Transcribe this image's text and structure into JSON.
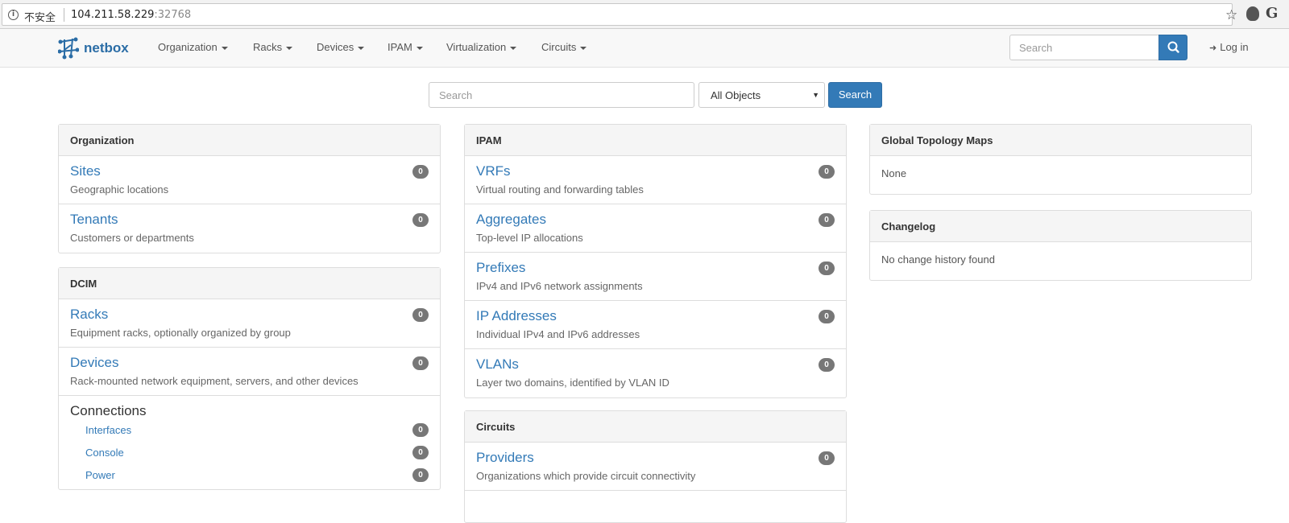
{
  "browser": {
    "security_label": "不安全",
    "url_host": "104.211.58.229",
    "url_port": ":32768"
  },
  "navbar": {
    "brand": "netbox",
    "menus": [
      "Organization",
      "Racks",
      "Devices",
      "IPAM",
      "Virtualization",
      "Circuits"
    ],
    "search_placeholder": "Search",
    "login": "Log in"
  },
  "search": {
    "placeholder": "Search",
    "object_type": "All Objects",
    "button": "Search"
  },
  "organization": {
    "title": "Organization",
    "items": [
      {
        "title": "Sites",
        "desc": "Geographic locations",
        "count": "0"
      },
      {
        "title": "Tenants",
        "desc": "Customers or departments",
        "count": "0"
      }
    ]
  },
  "dcim": {
    "title": "DCIM",
    "items": [
      {
        "title": "Racks",
        "desc": "Equipment racks, optionally organized by group",
        "count": "0"
      },
      {
        "title": "Devices",
        "desc": "Rack-mounted network equipment, servers, and other devices",
        "count": "0"
      }
    ],
    "connections": {
      "title": "Connections",
      "items": [
        {
          "label": "Interfaces",
          "count": "0"
        },
        {
          "label": "Console",
          "count": "0"
        },
        {
          "label": "Power",
          "count": "0"
        }
      ]
    }
  },
  "ipam": {
    "title": "IPAM",
    "items": [
      {
        "title": "VRFs",
        "desc": "Virtual routing and forwarding tables",
        "count": "0"
      },
      {
        "title": "Aggregates",
        "desc": "Top-level IP allocations",
        "count": "0"
      },
      {
        "title": "Prefixes",
        "desc": "IPv4 and IPv6 network assignments",
        "count": "0"
      },
      {
        "title": "IP Addresses",
        "desc": "Individual IPv4 and IPv6 addresses",
        "count": "0"
      },
      {
        "title": "VLANs",
        "desc": "Layer two domains, identified by VLAN ID",
        "count": "0"
      }
    ]
  },
  "circuits": {
    "title": "Circuits",
    "items": [
      {
        "title": "Providers",
        "desc": "Organizations which provide circuit connectivity",
        "count": "0"
      }
    ]
  },
  "topology": {
    "title": "Global Topology Maps",
    "body": "None"
  },
  "changelog": {
    "title": "Changelog",
    "body": "No change history found"
  },
  "colors": {
    "link": "#337ab7",
    "badge": "#777777",
    "primary_button": "#337ab7"
  }
}
